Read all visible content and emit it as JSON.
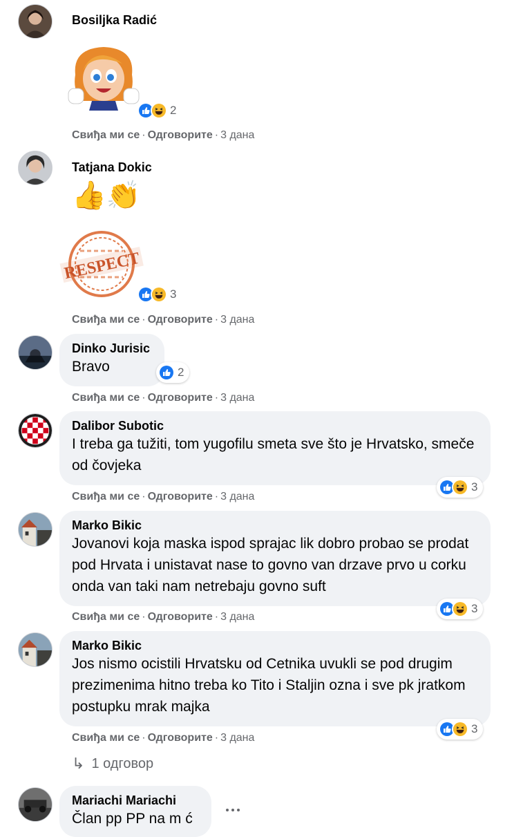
{
  "labels": {
    "like": "Свиђа ми се",
    "reply": "Одговорите",
    "sep": "·",
    "time": "3 дана"
  },
  "comments": [
    {
      "author": "Bosiljka Radić",
      "reaction_count": "2"
    },
    {
      "author": "Tatjana Dokic",
      "emoji": "👍👏",
      "sticker_text": "RESPECT",
      "reaction_count": "3"
    },
    {
      "author": "Dinko Jurisic",
      "text": "Bravo",
      "reaction_count": "2"
    },
    {
      "author": "Dalibor Subotic",
      "text": "I treba ga tužiti, tom yugofilu smeta sve što je Hrvatsko, smeče od čovjeka",
      "reaction_count": "3"
    },
    {
      "author": "Marko Bikic",
      "text": "Jovanovi koja maska ispod sprajac lik dobro probao se prodat pod Hrvata i unistavat nase to govno van drzave prvo u corku onda van taki nam netrebaju govno suft",
      "reaction_count": "3"
    },
    {
      "author": "Marko Bikic",
      "text": "Jos nismo ocistili Hrvatsku od Cetnika uvukli se pod drugim prezimenima hitno treba ko Tito i Staljin ozna i sve pk jratkom postupku mrak majka",
      "reaction_count": "3"
    },
    {
      "author": "Mariachi Mariachi",
      "text": "Član pp PP na m ć"
    }
  ],
  "replies_link": {
    "arrow": "↳",
    "label": "1 одговор"
  },
  "colors": {
    "like_blue": "#1877f2",
    "haha_yellow": "#f7b928",
    "meta_gray": "#65676b",
    "bubble_bg": "#f0f2f5"
  },
  "icons": [
    "like-reaction-icon",
    "haha-reaction-icon",
    "more-options-icon",
    "reply-arrow-icon"
  ]
}
